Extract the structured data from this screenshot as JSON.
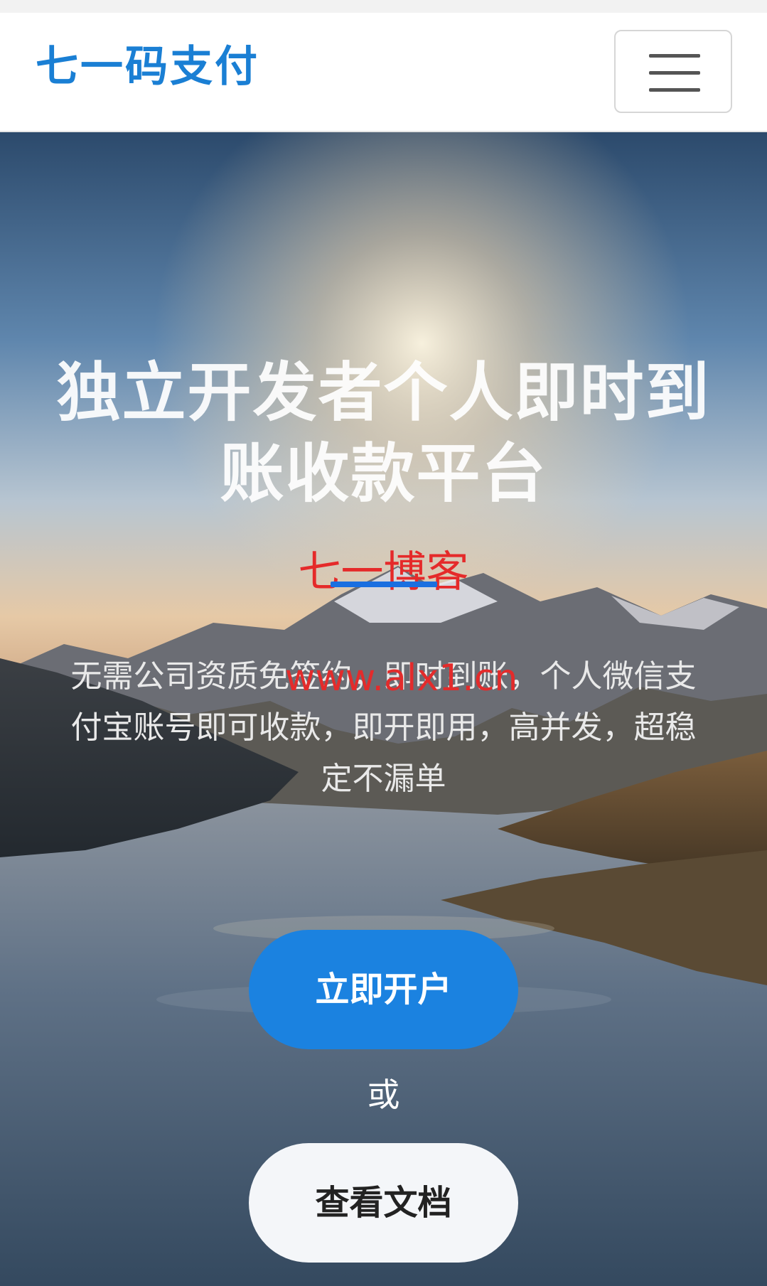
{
  "header": {
    "brand": "七一码支付",
    "menu_icon": "hamburger-menu-icon"
  },
  "hero": {
    "title_line1": "独立开发者个人即时到",
    "title_line2": "账收款平台",
    "description_line1": "无需公司资质免签约，即时到账，个人微信支",
    "description_line2": "付宝账号即可收款，即开即用，高并发，超稳",
    "description_line3": "定不漏单",
    "primary_button": "立即开户",
    "or_text": "或",
    "secondary_button": "查看文档"
  },
  "watermarks": {
    "blog": "七一博客",
    "url": "www.alx1.cn"
  },
  "colors": {
    "brand": "#1a7fd4",
    "primary_button": "#1b82e0",
    "watermark": "#e52a2a"
  }
}
